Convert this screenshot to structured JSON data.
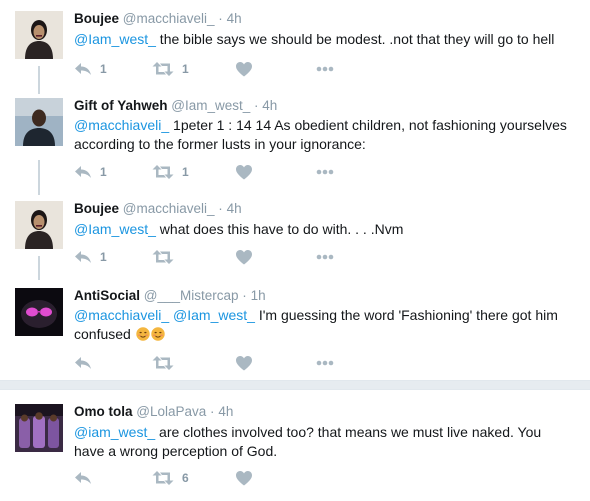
{
  "tweets": [
    {
      "name": "Boujee",
      "handle": "@macchiaveli_",
      "dot": "·",
      "time": "4h",
      "mention": "@Iam_west_",
      "text": " the bible says we should be modest. .not that they will go to hell",
      "reply_count": "1",
      "retweet_count": "1",
      "like_count": ""
    },
    {
      "name": "Gift of Yahweh",
      "handle": "@Iam_west_",
      "dot": "·",
      "time": "4h",
      "mention": "@macchiaveli_",
      "text": " 1peter 1 : 14 14 As obedient children, not fashioning yourselves according to the former lusts in your ignorance:",
      "reply_count": "1",
      "retweet_count": "1",
      "like_count": ""
    },
    {
      "name": "Boujee",
      "handle": "@macchiaveli_",
      "dot": "·",
      "time": "4h",
      "mention": "@Iam_west_",
      "text": " what does this have to do with. . . .Nvm",
      "reply_count": "1",
      "retweet_count": "",
      "like_count": ""
    },
    {
      "name": "AntiSocial",
      "handle": "@___Mistercap",
      "dot": "·",
      "time": "1h",
      "mention": "@macchiaveli_ @Iam_west_",
      "text": " I'm guessing the word 'Fashioning' there got him confused",
      "reply_count": "",
      "retweet_count": "",
      "like_count": ""
    },
    {
      "name": "Omo tola",
      "handle": "@LolaPava",
      "dot": "·",
      "time": "4h",
      "mention": "@iam_west_",
      "text": " are clothes involved too? that means we must live naked. You have a wrong perception of God.",
      "reply_count": "",
      "retweet_count": "6",
      "like_count": ""
    }
  ],
  "colors": {
    "link": "#1b95e0",
    "muted": "#8899a6",
    "icon": "#aab8c2",
    "thread_line": "#ccd6dd",
    "separator": "#e6ecf0"
  },
  "icons": [
    "reply-icon",
    "retweet-icon",
    "heart-icon",
    "more-icon",
    "smiling-face-emoji"
  ]
}
